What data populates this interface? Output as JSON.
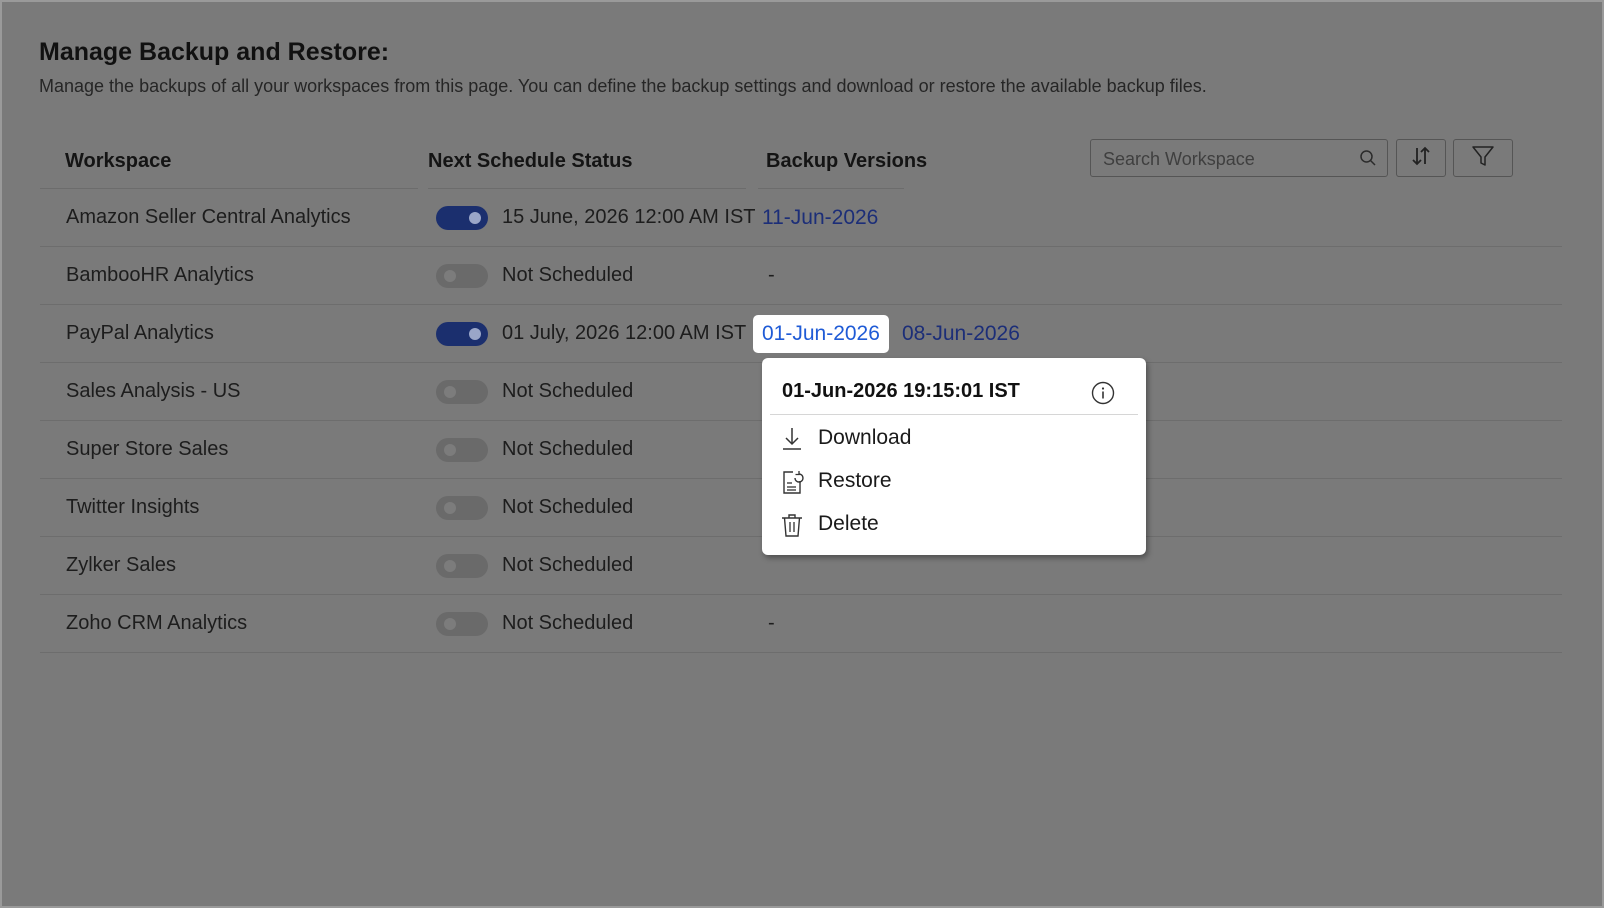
{
  "page": {
    "title": "Manage Backup and Restore:",
    "description": "Manage the backups of all your workspaces from this page. You can define the backup settings and download or restore the available backup files."
  },
  "table": {
    "headers": {
      "workspace": "Workspace",
      "schedule": "Next Schedule Status",
      "versions": "Backup Versions"
    },
    "rows": [
      {
        "workspace": "Amazon Seller Central Analytics",
        "scheduled": true,
        "schedule": "15 June, 2026 12:00 AM IST",
        "versions": [
          "11-Jun-2026"
        ]
      },
      {
        "workspace": "BambooHR Analytics",
        "scheduled": false,
        "schedule": "Not Scheduled",
        "versions": [],
        "empty": "-"
      },
      {
        "workspace": "PayPal Analytics",
        "scheduled": true,
        "schedule": "01 July, 2026 12:00 AM IST",
        "versions": [
          "01-Jun-2026",
          "08-Jun-2026"
        ]
      },
      {
        "workspace": "Sales Analysis - US",
        "scheduled": false,
        "schedule": "Not Scheduled",
        "versions": []
      },
      {
        "workspace": "Super Store Sales",
        "scheduled": false,
        "schedule": "Not Scheduled",
        "versions": []
      },
      {
        "workspace": "Twitter Insights",
        "scheduled": false,
        "schedule": "Not Scheduled",
        "versions": []
      },
      {
        "workspace": "Zylker Sales",
        "scheduled": false,
        "schedule": "Not Scheduled",
        "versions": []
      },
      {
        "workspace": "Zoho CRM Analytics",
        "scheduled": false,
        "schedule": "Not Scheduled",
        "versions": [],
        "empty": "-"
      }
    ]
  },
  "search": {
    "placeholder": "Search Workspace",
    "value": ""
  },
  "toolbar": {
    "sort_icon": "sort-icon",
    "filter_icon": "filter-icon"
  },
  "popover": {
    "title": "01-Jun-2026 19:15:01 IST",
    "items": [
      {
        "label": "Download",
        "icon": "download-icon"
      },
      {
        "label": "Restore",
        "icon": "restore-icon"
      },
      {
        "label": "Delete",
        "icon": "trash-icon"
      }
    ]
  },
  "colors": {
    "overlay": "#7a7a7a",
    "toggle_on": "#1b2f6e",
    "link": "#1c2e78",
    "selected_link": "#1f5bd6"
  }
}
